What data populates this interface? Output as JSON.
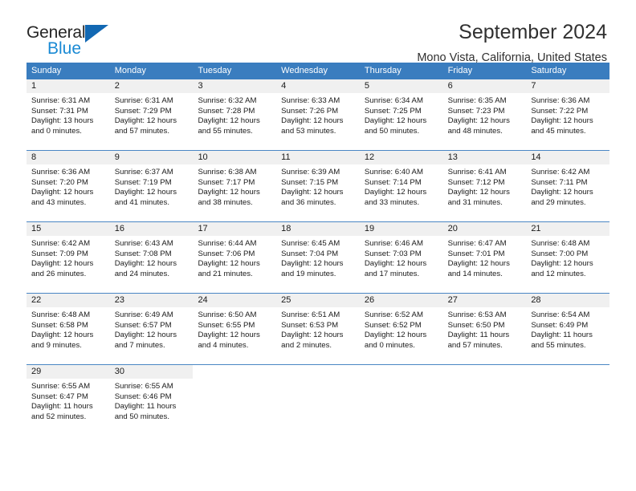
{
  "brand": {
    "name_top": "General",
    "name_bottom": "Blue",
    "triangle_color": "#1268b3",
    "blue_text_color": "#1a8ad4"
  },
  "header": {
    "title": "September 2024",
    "subtitle": "Mono Vista, California, United States"
  },
  "theme": {
    "header_row_bg": "#3a7dbf",
    "daynum_band_bg": "#f0f0f0",
    "row_divider": "#4a86c4"
  },
  "weekdays": [
    "Sunday",
    "Monday",
    "Tuesday",
    "Wednesday",
    "Thursday",
    "Friday",
    "Saturday"
  ],
  "weeks": [
    [
      {
        "day": "1",
        "sunrise": "Sunrise: 6:31 AM",
        "sunset": "Sunset: 7:31 PM",
        "daylight1": "Daylight: 13 hours",
        "daylight2": "and 0 minutes."
      },
      {
        "day": "2",
        "sunrise": "Sunrise: 6:31 AM",
        "sunset": "Sunset: 7:29 PM",
        "daylight1": "Daylight: 12 hours",
        "daylight2": "and 57 minutes."
      },
      {
        "day": "3",
        "sunrise": "Sunrise: 6:32 AM",
        "sunset": "Sunset: 7:28 PM",
        "daylight1": "Daylight: 12 hours",
        "daylight2": "and 55 minutes."
      },
      {
        "day": "4",
        "sunrise": "Sunrise: 6:33 AM",
        "sunset": "Sunset: 7:26 PM",
        "daylight1": "Daylight: 12 hours",
        "daylight2": "and 53 minutes."
      },
      {
        "day": "5",
        "sunrise": "Sunrise: 6:34 AM",
        "sunset": "Sunset: 7:25 PM",
        "daylight1": "Daylight: 12 hours",
        "daylight2": "and 50 minutes."
      },
      {
        "day": "6",
        "sunrise": "Sunrise: 6:35 AM",
        "sunset": "Sunset: 7:23 PM",
        "daylight1": "Daylight: 12 hours",
        "daylight2": "and 48 minutes."
      },
      {
        "day": "7",
        "sunrise": "Sunrise: 6:36 AM",
        "sunset": "Sunset: 7:22 PM",
        "daylight1": "Daylight: 12 hours",
        "daylight2": "and 45 minutes."
      }
    ],
    [
      {
        "day": "8",
        "sunrise": "Sunrise: 6:36 AM",
        "sunset": "Sunset: 7:20 PM",
        "daylight1": "Daylight: 12 hours",
        "daylight2": "and 43 minutes."
      },
      {
        "day": "9",
        "sunrise": "Sunrise: 6:37 AM",
        "sunset": "Sunset: 7:19 PM",
        "daylight1": "Daylight: 12 hours",
        "daylight2": "and 41 minutes."
      },
      {
        "day": "10",
        "sunrise": "Sunrise: 6:38 AM",
        "sunset": "Sunset: 7:17 PM",
        "daylight1": "Daylight: 12 hours",
        "daylight2": "and 38 minutes."
      },
      {
        "day": "11",
        "sunrise": "Sunrise: 6:39 AM",
        "sunset": "Sunset: 7:15 PM",
        "daylight1": "Daylight: 12 hours",
        "daylight2": "and 36 minutes."
      },
      {
        "day": "12",
        "sunrise": "Sunrise: 6:40 AM",
        "sunset": "Sunset: 7:14 PM",
        "daylight1": "Daylight: 12 hours",
        "daylight2": "and 33 minutes."
      },
      {
        "day": "13",
        "sunrise": "Sunrise: 6:41 AM",
        "sunset": "Sunset: 7:12 PM",
        "daylight1": "Daylight: 12 hours",
        "daylight2": "and 31 minutes."
      },
      {
        "day": "14",
        "sunrise": "Sunrise: 6:42 AM",
        "sunset": "Sunset: 7:11 PM",
        "daylight1": "Daylight: 12 hours",
        "daylight2": "and 29 minutes."
      }
    ],
    [
      {
        "day": "15",
        "sunrise": "Sunrise: 6:42 AM",
        "sunset": "Sunset: 7:09 PM",
        "daylight1": "Daylight: 12 hours",
        "daylight2": "and 26 minutes."
      },
      {
        "day": "16",
        "sunrise": "Sunrise: 6:43 AM",
        "sunset": "Sunset: 7:08 PM",
        "daylight1": "Daylight: 12 hours",
        "daylight2": "and 24 minutes."
      },
      {
        "day": "17",
        "sunrise": "Sunrise: 6:44 AM",
        "sunset": "Sunset: 7:06 PM",
        "daylight1": "Daylight: 12 hours",
        "daylight2": "and 21 minutes."
      },
      {
        "day": "18",
        "sunrise": "Sunrise: 6:45 AM",
        "sunset": "Sunset: 7:04 PM",
        "daylight1": "Daylight: 12 hours",
        "daylight2": "and 19 minutes."
      },
      {
        "day": "19",
        "sunrise": "Sunrise: 6:46 AM",
        "sunset": "Sunset: 7:03 PM",
        "daylight1": "Daylight: 12 hours",
        "daylight2": "and 17 minutes."
      },
      {
        "day": "20",
        "sunrise": "Sunrise: 6:47 AM",
        "sunset": "Sunset: 7:01 PM",
        "daylight1": "Daylight: 12 hours",
        "daylight2": "and 14 minutes."
      },
      {
        "day": "21",
        "sunrise": "Sunrise: 6:48 AM",
        "sunset": "Sunset: 7:00 PM",
        "daylight1": "Daylight: 12 hours",
        "daylight2": "and 12 minutes."
      }
    ],
    [
      {
        "day": "22",
        "sunrise": "Sunrise: 6:48 AM",
        "sunset": "Sunset: 6:58 PM",
        "daylight1": "Daylight: 12 hours",
        "daylight2": "and 9 minutes."
      },
      {
        "day": "23",
        "sunrise": "Sunrise: 6:49 AM",
        "sunset": "Sunset: 6:57 PM",
        "daylight1": "Daylight: 12 hours",
        "daylight2": "and 7 minutes."
      },
      {
        "day": "24",
        "sunrise": "Sunrise: 6:50 AM",
        "sunset": "Sunset: 6:55 PM",
        "daylight1": "Daylight: 12 hours",
        "daylight2": "and 4 minutes."
      },
      {
        "day": "25",
        "sunrise": "Sunrise: 6:51 AM",
        "sunset": "Sunset: 6:53 PM",
        "daylight1": "Daylight: 12 hours",
        "daylight2": "and 2 minutes."
      },
      {
        "day": "26",
        "sunrise": "Sunrise: 6:52 AM",
        "sunset": "Sunset: 6:52 PM",
        "daylight1": "Daylight: 12 hours",
        "daylight2": "and 0 minutes."
      },
      {
        "day": "27",
        "sunrise": "Sunrise: 6:53 AM",
        "sunset": "Sunset: 6:50 PM",
        "daylight1": "Daylight: 11 hours",
        "daylight2": "and 57 minutes."
      },
      {
        "day": "28",
        "sunrise": "Sunrise: 6:54 AM",
        "sunset": "Sunset: 6:49 PM",
        "daylight1": "Daylight: 11 hours",
        "daylight2": "and 55 minutes."
      }
    ],
    [
      {
        "day": "29",
        "sunrise": "Sunrise: 6:55 AM",
        "sunset": "Sunset: 6:47 PM",
        "daylight1": "Daylight: 11 hours",
        "daylight2": "and 52 minutes."
      },
      {
        "day": "30",
        "sunrise": "Sunrise: 6:55 AM",
        "sunset": "Sunset: 6:46 PM",
        "daylight1": "Daylight: 11 hours",
        "daylight2": "and 50 minutes."
      },
      {
        "day": "",
        "sunrise": "",
        "sunset": "",
        "daylight1": "",
        "daylight2": ""
      },
      {
        "day": "",
        "sunrise": "",
        "sunset": "",
        "daylight1": "",
        "daylight2": ""
      },
      {
        "day": "",
        "sunrise": "",
        "sunset": "",
        "daylight1": "",
        "daylight2": ""
      },
      {
        "day": "",
        "sunrise": "",
        "sunset": "",
        "daylight1": "",
        "daylight2": ""
      },
      {
        "day": "",
        "sunrise": "",
        "sunset": "",
        "daylight1": "",
        "daylight2": ""
      }
    ]
  ]
}
